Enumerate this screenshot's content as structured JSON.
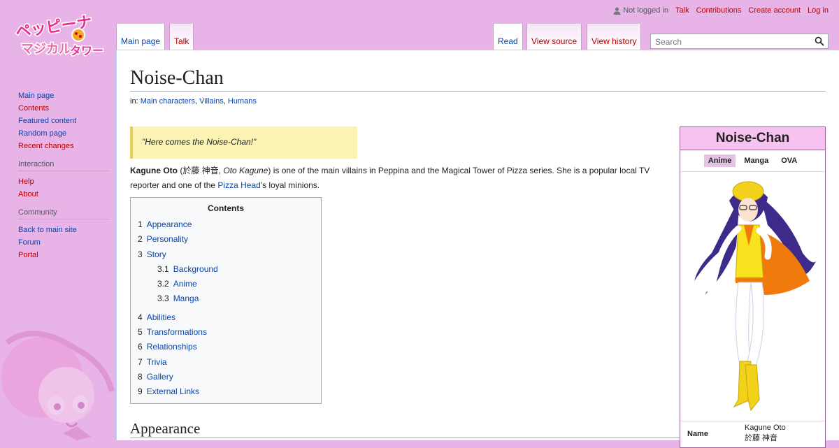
{
  "personal": {
    "status": "Not logged in",
    "links": [
      "Talk",
      "Contributions",
      "Create account",
      "Log in"
    ]
  },
  "logo_text": "ペッピーナ マジカル タワー",
  "sidebar": {
    "main": [
      "Main page",
      "Contents",
      "Featured content",
      "Random page",
      "Recent changes"
    ],
    "interaction_heading": "Interaction",
    "interaction": [
      "Help",
      "About"
    ],
    "community_heading": "Community",
    "community": [
      "Back to main site",
      "Forum",
      "Portal"
    ]
  },
  "tabs": {
    "main_page": "Main page",
    "talk": "Talk",
    "read": "Read",
    "view_source": "View source",
    "view_history": "View history"
  },
  "search": {
    "placeholder": "Search"
  },
  "page": {
    "title": "Noise-Chan",
    "categories_prefix": "in:",
    "categories": [
      "Main characters",
      "Villains",
      "Humans"
    ],
    "quote": "\"Here comes the Noise-Chan!\"",
    "intro": {
      "name": "Kagune Oto",
      "jp_name": "於藤 神音",
      "romaji": "Oto Kagune",
      "text1": " is one of the main villains in Peppina and the Magical Tower of Pizza series. She is a popular local TV reporter and one of the ",
      "link": "Pizza Head",
      "text2": "'s loyal minions."
    },
    "toc": {
      "title": "Contents",
      "items": [
        {
          "num": "1",
          "label": "Appearance"
        },
        {
          "num": "2",
          "label": "Personality"
        },
        {
          "num": "3",
          "label": "Story"
        },
        {
          "num": "3.1",
          "label": "Background"
        },
        {
          "num": "3.2",
          "label": "Anime"
        },
        {
          "num": "3.3",
          "label": "Manga"
        },
        {
          "num": "4",
          "label": "Abilities"
        },
        {
          "num": "5",
          "label": "Transformations"
        },
        {
          "num": "6",
          "label": "Relationships"
        },
        {
          "num": "7",
          "label": "Trivia"
        },
        {
          "num": "8",
          "label": "Gallery"
        },
        {
          "num": "9",
          "label": "External Links"
        }
      ]
    },
    "section_heading": "Appearance"
  },
  "infobox": {
    "title": "Noise-Chan",
    "tabs": [
      "Anime",
      "Manga",
      "OVA"
    ],
    "active_tab": "Anime",
    "name_label": "Name",
    "name_value": "Kagune Oto",
    "name_value_jp": "於藤 神音"
  },
  "colors": {
    "sidebar_bg": "#e8b4e8",
    "infobox_header": "#f8c2f0",
    "quote_bg": "#fbf3b4",
    "link_blue": "#0645ad",
    "link_red": "#ba0000"
  }
}
